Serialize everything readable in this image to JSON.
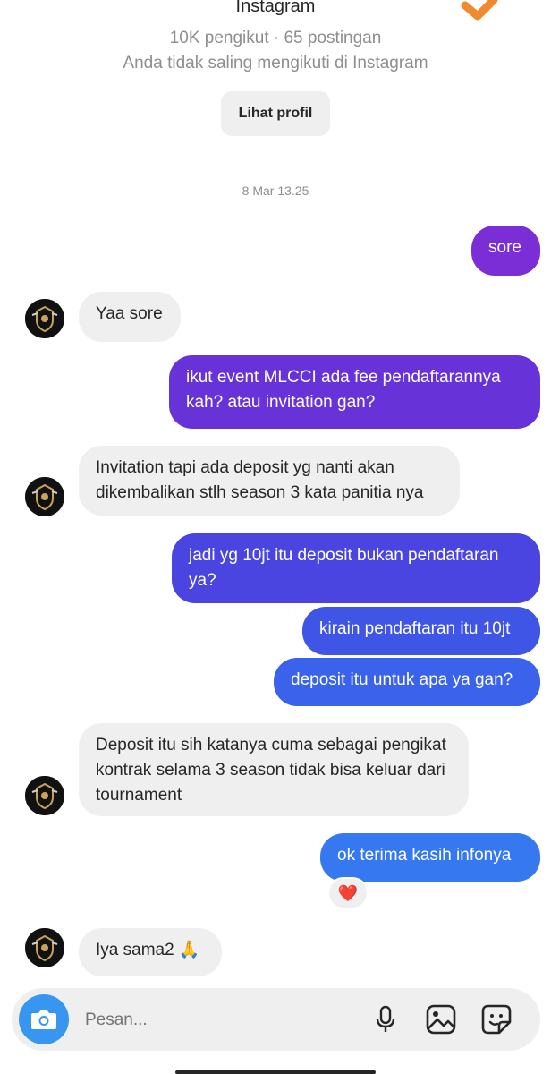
{
  "header": {
    "platform": "Instagram",
    "stats": "10K pengikut · 65 postingan",
    "follow_status": "Anda tidak saling mengikuti di Instagram",
    "view_profile_label": "Lihat profil"
  },
  "thread": {
    "timestamp": "8 Mar 13.25",
    "messages": [
      {
        "from": "me",
        "text": "sore",
        "color": "#7b2ed6"
      },
      {
        "from": "them",
        "text": "Yaa sore"
      },
      {
        "from": "me",
        "text": "ikut event MLCCI  ada fee pendaftarannya kah? atau invitation gan?",
        "color": "#6733d9"
      },
      {
        "from": "them",
        "text": "Invitation tapi ada deposit yg nanti akan dikembalikan stlh season 3 kata panitia nya"
      },
      {
        "from": "me",
        "text": "jadi yg 10jt itu deposit bukan pendaftaran ya?",
        "color": "#4a45e0"
      },
      {
        "from": "me",
        "text": "kirain pendaftaran itu 10jt",
        "color": "#3f55e6"
      },
      {
        "from": "me",
        "text": "deposit itu untuk apa ya gan?",
        "color": "#3a62ea"
      },
      {
        "from": "them",
        "text": "Deposit itu sih katanya cuma sebagai pengikat kontrak selama 3 season tidak bisa keluar dari tournament"
      },
      {
        "from": "me",
        "text": "ok terima kasih infonya",
        "color": "#3578f0"
      },
      {
        "from": "them",
        "text": "Iya sama2 🙏"
      }
    ],
    "reaction": "❤️"
  },
  "composer": {
    "placeholder": "Pesan...",
    "icons": [
      "camera-icon",
      "microphone-icon",
      "gallery-icon",
      "sticker-icon"
    ],
    "camera_color": "#3797f0"
  }
}
